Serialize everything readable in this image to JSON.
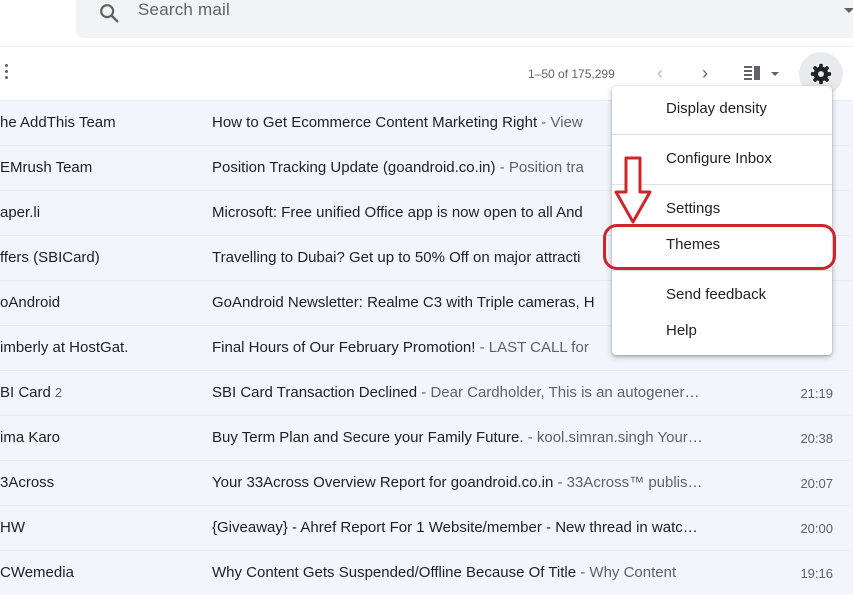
{
  "search": {
    "placeholder": "Search mail",
    "icon": "search-icon"
  },
  "toolbar": {
    "pagination": "1–50 of 175,299",
    "prev_icon": "‹",
    "next_icon": "›"
  },
  "emails": [
    {
      "sender": "he AddThis Team",
      "count": "",
      "subject": "How to Get Ecommerce Content Marketing Right",
      "snippet": " - View ",
      "time": ""
    },
    {
      "sender": "EMrush Team",
      "count": "",
      "subject": "Position Tracking Update (goandroid.co.in)",
      "snippet": " - Position tra",
      "time": ""
    },
    {
      "sender": "aper.li",
      "count": "",
      "subject": "Microsoft: Free unified Office app is now open to all And",
      "snippet": "",
      "time": ""
    },
    {
      "sender": "ffers (SBICard)",
      "count": "",
      "subject": "Travelling to Dubai? Get up to 50% Off on major attracti",
      "snippet": "",
      "time": ""
    },
    {
      "sender": "oAndroid",
      "count": "",
      "subject": "GoAndroid Newsletter: Realme C3 with Triple cameras, H",
      "snippet": "",
      "time": ""
    },
    {
      "sender": "imberly at HostGat.",
      "count": "",
      "subject": "Final Hours of Our February Promotion!",
      "snippet": " - LAST CALL for",
      "time": ""
    },
    {
      "sender": "BI Card",
      "count": "2",
      "subject": "SBI Card Transaction Declined",
      "snippet": " - Dear Cardholder, This is an autogener…",
      "time": "21:19"
    },
    {
      "sender": "ima Karo",
      "count": "",
      "subject": "Buy Term Plan and Secure your Family Future.",
      "snippet": " - kool.simran.singh Your…",
      "time": "20:38"
    },
    {
      "sender": "3Across",
      "count": "",
      "subject": "Your 33Across Overview Report for goandroid.co.in",
      "snippet": " - 33Across™ publis…",
      "time": "20:07"
    },
    {
      "sender": "HW",
      "count": "",
      "subject": "{Giveaway} - Ahref Report For 1 Website/member - New thread in watc…",
      "snippet": "",
      "time": "20:00"
    },
    {
      "sender": "CWemedia",
      "count": "",
      "subject": "Why Content Gets Suspended/Offline Because Of Title",
      "snippet": " - Why Content",
      "time": "19:16"
    }
  ],
  "settings_menu": {
    "display_density": "Display density",
    "configure_inbox": "Configure Inbox",
    "settings": "Settings",
    "themes": "Themes",
    "send_feedback": "Send feedback",
    "help": "Help"
  },
  "colors": {
    "highlight": "#d0242b",
    "row_bg": "#f2f6fc"
  }
}
